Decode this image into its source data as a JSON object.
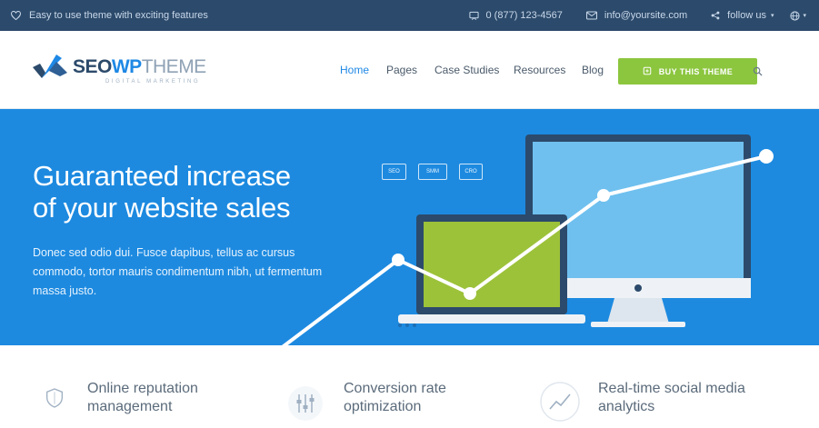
{
  "topbar": {
    "tagline": "Easy to use theme with exciting features",
    "phone": "0 (877) 123-4567",
    "email": "info@yoursite.com",
    "follow": "follow us",
    "icons": [
      "heart-icon",
      "phone-icon",
      "mail-icon",
      "share-icon",
      "globe-icon"
    ]
  },
  "header": {
    "logo": {
      "part1": "SEO",
      "part2": "WP",
      "part3": "THEME",
      "sub": "DIGITAL MARKETING"
    },
    "nav": [
      {
        "label": "Home",
        "active": true
      },
      {
        "label": "Pages"
      },
      {
        "label": "Case Studies"
      },
      {
        "label": "Resources"
      },
      {
        "label": "Blog"
      }
    ],
    "cta": "BUY THIS THEME"
  },
  "hero": {
    "title_line1": "Guaranteed increase",
    "title_line2": "of your website sales",
    "description": "Donec sed odio dui. Fusce dapibus, tellus ac cursus commodo, tortor mauris condimentum nibh, ut fermentum massa justo.",
    "tags": [
      "SEO",
      "SMM",
      "CRO"
    ]
  },
  "features": [
    {
      "line1": "Online reputation",
      "line2": "management",
      "icon": "shield-icon"
    },
    {
      "line1": "Conversion rate",
      "line2": "optimization",
      "icon": "sliders-icon"
    },
    {
      "line1": "Real-time social media",
      "line2": "analytics",
      "icon": "trend-chart-icon"
    }
  ],
  "colors": {
    "topbar": "#2c4a6b",
    "hero": "#1d8ae0",
    "cta": "#8cc63f",
    "accent": "#1e88e5"
  }
}
